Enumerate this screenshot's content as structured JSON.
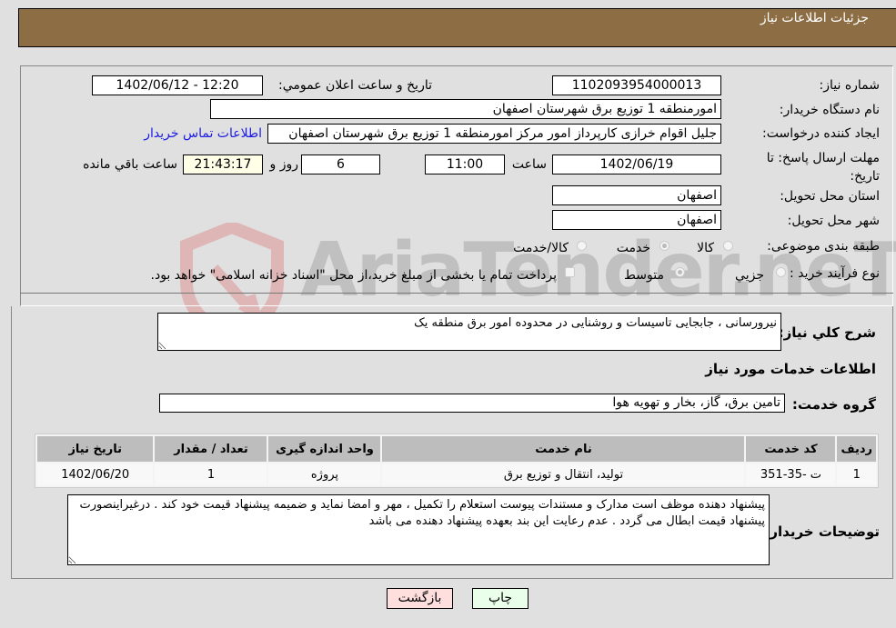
{
  "header": {
    "title": "جزئیات اطلاعات نیاز"
  },
  "form": {
    "need_number": {
      "label": "شماره نیاز:",
      "value": "1102093954000013"
    },
    "announce_datetime": {
      "label": "تاریخ و ساعت اعلان عمومي:",
      "value": "1402/06/12 - 12:20"
    },
    "buyer_org": {
      "label": "نام دستگاه خریدار:",
      "value": "امورمنطقه 1 توزیع برق شهرستان اصفهان"
    },
    "requester": {
      "label": "ایجاد کننده درخواست:",
      "value": "جلیل اقوام خرازی کارپرداز امور مرکز امورمنطقه 1 توزیع برق شهرستان اصفهان"
    },
    "buyer_contact_link": "اطلاعات تماس خریدار",
    "deadline": {
      "label": "مهلت ارسال پاسخ: تا تاریخ:",
      "date": "1402/06/19",
      "time_label": "ساعت",
      "time": "11:00",
      "days": "6",
      "days_label": "روز و",
      "remaining": "21:43:17",
      "remaining_label": "ساعت باقي مانده"
    },
    "province": {
      "label": "استان محل تحویل:",
      "value": "اصفهان"
    },
    "city": {
      "label": "شهر محل تحویل:",
      "value": "اصفهان"
    },
    "category": {
      "label": "طبقه بندی موضوعی:",
      "options": [
        "کالا",
        "خدمت",
        "کالا/خدمت"
      ],
      "selected": "خدمت"
    },
    "purchase_type": {
      "label": "نوع فرآیند خرید :",
      "options": [
        "جزيي",
        "متوسط"
      ],
      "selected": "متوسط",
      "treasury_note": "پرداخت تمام یا بخشی از مبلغ خرید،از محل \"اسناد خزانه اسلامی\" خواهد بود."
    }
  },
  "summary": {
    "label": "شرح كلي نياز:",
    "value": "نیرورسانی ، جابجایی تاسیسات و روشنایی در محدوده امور برق منطقه یک"
  },
  "services_section": {
    "title": "اطلاعات خدمات مورد نیاز",
    "group_label": "گروه خدمت:",
    "group_value": "تامین برق، گاز، بخار و تهویه هوا",
    "table": {
      "headers": [
        "ردیف",
        "کد خدمت",
        "نام خدمت",
        "واحد اندازه گیری",
        "تعداد / مقدار",
        "تاریخ نیاز"
      ],
      "rows": [
        [
          "1",
          "ت -35-351",
          "تولید، انتقال و توزیع برق",
          "پروژه",
          "1",
          "1402/06/20"
        ]
      ]
    }
  },
  "buyer_notes": {
    "label": "توضیحات خریدار:",
    "value": "پیشنهاد دهنده موظف است مدارک و مستندات پیوست استعلام را تکمیل ، مهر و امضا نماید و ضمیمه پیشنهاد قیمت خود کند . درغیراینصورت پیشنهاد قیمت ابطال می گردد . عدم رعایت این بند بعهده پیشنهاد دهنده می باشد"
  },
  "buttons": {
    "print": "چاپ",
    "back": "بازگشت"
  },
  "watermark": {
    "text": "AriaTender.neT"
  },
  "colors": {
    "header_bg": "#8d6e44",
    "page_bg": "#e0e0e0",
    "print_btn_bg": "#eaffea",
    "back_btn_bg": "#ffdede",
    "link": "#1a1ae6",
    "remaining_bg": "#ffffe8"
  }
}
